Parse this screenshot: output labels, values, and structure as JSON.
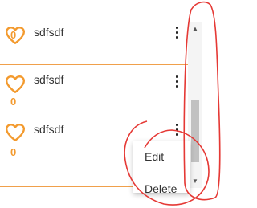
{
  "items": [
    {
      "name": "sdfsdf",
      "likes": "0"
    },
    {
      "name": "sdfsdf",
      "likes": "0"
    },
    {
      "name": "sdfsdf",
      "likes": "0"
    }
  ],
  "menu": {
    "edit_label": "Edit",
    "delete_label": "Delete"
  },
  "colors": {
    "accent": "#f39a2e",
    "separator": "#f0a04b",
    "annotation": "#e53935"
  },
  "icons": {
    "like": "heart-icon",
    "more": "more-vert-icon",
    "scroll_up": "arrow-up-icon",
    "scroll_down": "arrow-down-icon"
  }
}
